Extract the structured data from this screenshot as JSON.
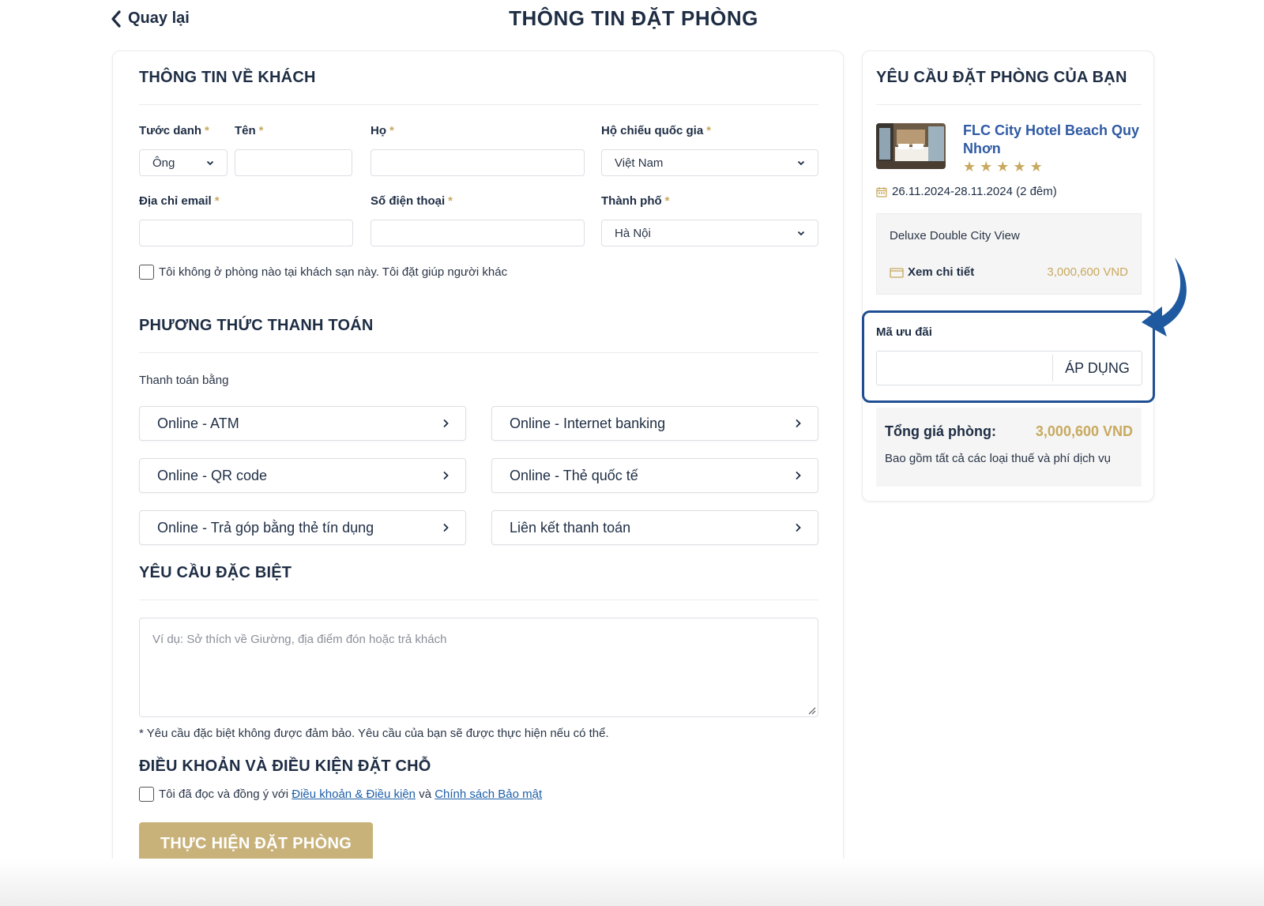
{
  "header": {
    "back_label": "Quay lại",
    "title": "THÔNG TIN ĐẶT PHÒNG"
  },
  "guest": {
    "section_title": "THÔNG TIN VỀ KHÁCH",
    "title_label": "Tước danh",
    "title_value": "Ông",
    "first_name_label": "Tên",
    "first_name_value": "",
    "last_name_label": "Họ",
    "last_name_value": "",
    "passport_label": "Hộ chiếu quốc gia",
    "passport_value": "Việt Nam",
    "email_label": "Địa chỉ email",
    "email_value": "",
    "phone_label": "Số điện thoại",
    "phone_value": "",
    "city_label": "Thành phố",
    "city_value": "Hà Nội",
    "required_mark": "*",
    "not_staying_label": "Tôi không ở phòng nào tại khách sạn này. Tôi đặt giúp người khác"
  },
  "payment": {
    "section_title": "PHƯƠNG THỨC THANH TOÁN",
    "pay_with_label": "Thanh toán bằng",
    "methods": [
      "Online - ATM",
      "Online - Internet banking",
      "Online - QR code",
      "Online - Thẻ quốc tế",
      "Online - Trả góp bằng thẻ tín dụng",
      "Liên kết thanh toán"
    ]
  },
  "special": {
    "section_title": "YÊU CẦU ĐẶC BIỆT",
    "placeholder": "Ví dụ: Sở thích về Giường, địa điểm đón hoặc trả khách",
    "note": "* Yêu cầu đặc biệt không được đảm bảo. Yêu cầu của bạn sẽ được thực hiện nếu có thể."
  },
  "terms": {
    "section_title": "ĐIỀU KHOẢN VÀ ĐIỀU KIỆN ĐẶT CHỖ",
    "text_before": "Tôi đã đọc và đồng ý với",
    "terms_link": "Điều khoản & Điều kiện",
    "text_and": "và",
    "privacy_link": "Chính sách Bảo mật"
  },
  "submit_label": "THỰC HIỆN ĐẶT PHÒNG",
  "summary": {
    "section_title": "YÊU CẦU ĐẶT PHÒNG CỦA BẠN",
    "hotel_name": "FLC City Hotel Beach Quy Nhơn",
    "stars": 5,
    "dates": "26.11.2024-28.11.2024 (2 đêm)",
    "room_name": "Deluxe Double City View",
    "detail_label": "Xem chi tiết",
    "room_price": "3,000,600 VND",
    "promo_label": "Mã ưu đãi",
    "promo_value": "",
    "apply_label": "ÁP DỤNG",
    "total_label": "Tổng giá phòng:",
    "total_value": "3,000,600 VND",
    "total_note": "Bao gồm tất cả các loại thuế và phí dịch vụ"
  },
  "colors": {
    "gold": "#c8a95e",
    "navy": "#1e2d44",
    "highlight_border": "#1f4f92",
    "link_blue": "#2f5aa4"
  }
}
